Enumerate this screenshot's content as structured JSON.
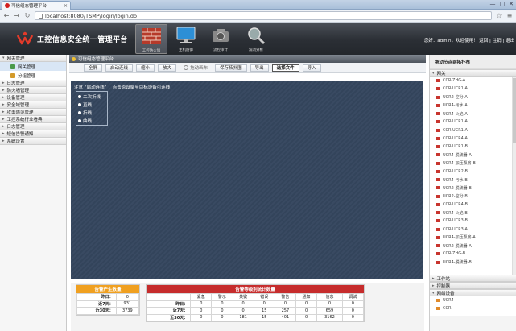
{
  "browser": {
    "tab_title": "可信组态管理平台",
    "url": "localhost:8080/TSMP/login/login.do",
    "window_buttons": [
      "—",
      "□",
      "✕"
    ]
  },
  "header": {
    "system_name": "工控信息安全统一管理平台",
    "modules": [
      {
        "label": "工控防火墙",
        "active": true
      },
      {
        "label": "主机防御",
        "active": false
      },
      {
        "label": "流控审计",
        "active": false
      },
      {
        "label": "漏洞分析",
        "active": false
      }
    ],
    "user_text": "您好：admin，欢迎使用！",
    "user_links": [
      "返回",
      "注销",
      "退出"
    ]
  },
  "left_nav": {
    "items": [
      {
        "label": "网关管理",
        "expanded": true
      },
      {
        "label": "日志管理",
        "expanded": false
      },
      {
        "label": "防火墙管理",
        "expanded": false
      },
      {
        "label": "设备管理",
        "expanded": false
      },
      {
        "label": "安全域管理",
        "expanded": false
      },
      {
        "label": "攻击防范管理",
        "expanded": false
      },
      {
        "label": "工控系统行业看典",
        "expanded": false
      },
      {
        "label": "日志管理",
        "expanded": false
      },
      {
        "label": "短信告警通知",
        "expanded": false
      },
      {
        "label": "系统设置",
        "expanded": false
      }
    ],
    "sub_items": [
      {
        "label": "网关管理",
        "selected": true
      },
      {
        "label": "分组管理",
        "selected": false
      }
    ]
  },
  "main": {
    "panel_title": "可信组态管理平台",
    "toolbar": [
      {
        "label": "全屏",
        "style": "normal"
      },
      {
        "label": "启动连线",
        "style": "normal"
      },
      {
        "label": "缩小",
        "style": "normal"
      },
      {
        "label": "放大",
        "style": "normal"
      },
      {
        "label": "拖动画布",
        "style": "disabled"
      },
      {
        "label": "保存拓扑图",
        "style": "normal"
      },
      {
        "label": "导出",
        "style": "normal"
      },
      {
        "label": "选择文件",
        "style": "highlight"
      },
      {
        "label": "导入",
        "style": "normal"
      }
    ],
    "hint": "注意 “启动连线” ，点击原设备至目标设备可连线",
    "legend": [
      {
        "label": "二次折线"
      },
      {
        "label": "直线"
      },
      {
        "label": "折线"
      },
      {
        "label": "曲线"
      }
    ],
    "alarm_gen": {
      "title": "告警产生数量",
      "rows": [
        {
          "label": "昨日：",
          "value": "0"
        },
        {
          "label": "近7天：",
          "value": "931"
        },
        {
          "label": "近30天：",
          "value": "3739"
        }
      ]
    },
    "alarm_level": {
      "title": "告警等级别统计数量",
      "columns": [
        "",
        "紧急",
        "警示",
        "关键",
        "错误",
        "警告",
        "通知",
        "信息",
        "调试"
      ],
      "rows": [
        {
          "label": "昨日：",
          "values": [
            "0",
            "0",
            "0",
            "0",
            "0",
            "0",
            "0",
            "0"
          ]
        },
        {
          "label": "近7天：",
          "values": [
            "0",
            "0",
            "0",
            "15",
            "257",
            "0",
            "659",
            "0"
          ]
        },
        {
          "label": "近30天：",
          "values": [
            "0",
            "0",
            "181",
            "15",
            "401",
            "0",
            "3162",
            "0"
          ]
        }
      ]
    }
  },
  "right_panel": {
    "header": "拖动节点到拓扑布",
    "sections": [
      "网关",
      "工作站",
      "控制器",
      "网络设备"
    ],
    "gateway_items": [
      "CCR-ZHG-A",
      "CCR-UCR1-A",
      "UCR2-空分-A",
      "UCR4-污水-A",
      "UCR4-火焰-A",
      "CCR-UCR1-A",
      "CCR-UCR1-A",
      "CCR-UCR4-A",
      "CCR-UCR1-B",
      "UCR4-脱硫器-A",
      "UCR4-加压泵房-B",
      "CCR-UCR2-B",
      "UCR4-污水-B",
      "UCR2-脱硫器-B",
      "UCR2-空分-B",
      "CCR-UCR4-B",
      "UCR4-火焰-B",
      "CCR-UCR3-B",
      "CCR-UCR3-A",
      "UCR4-加压泵房-A",
      "UCR2-脱硫器-A",
      "CCR-ZHG-B",
      "UCR4-脱硫器-B"
    ],
    "network_items": [
      "UCR4",
      "CCR"
    ]
  }
}
